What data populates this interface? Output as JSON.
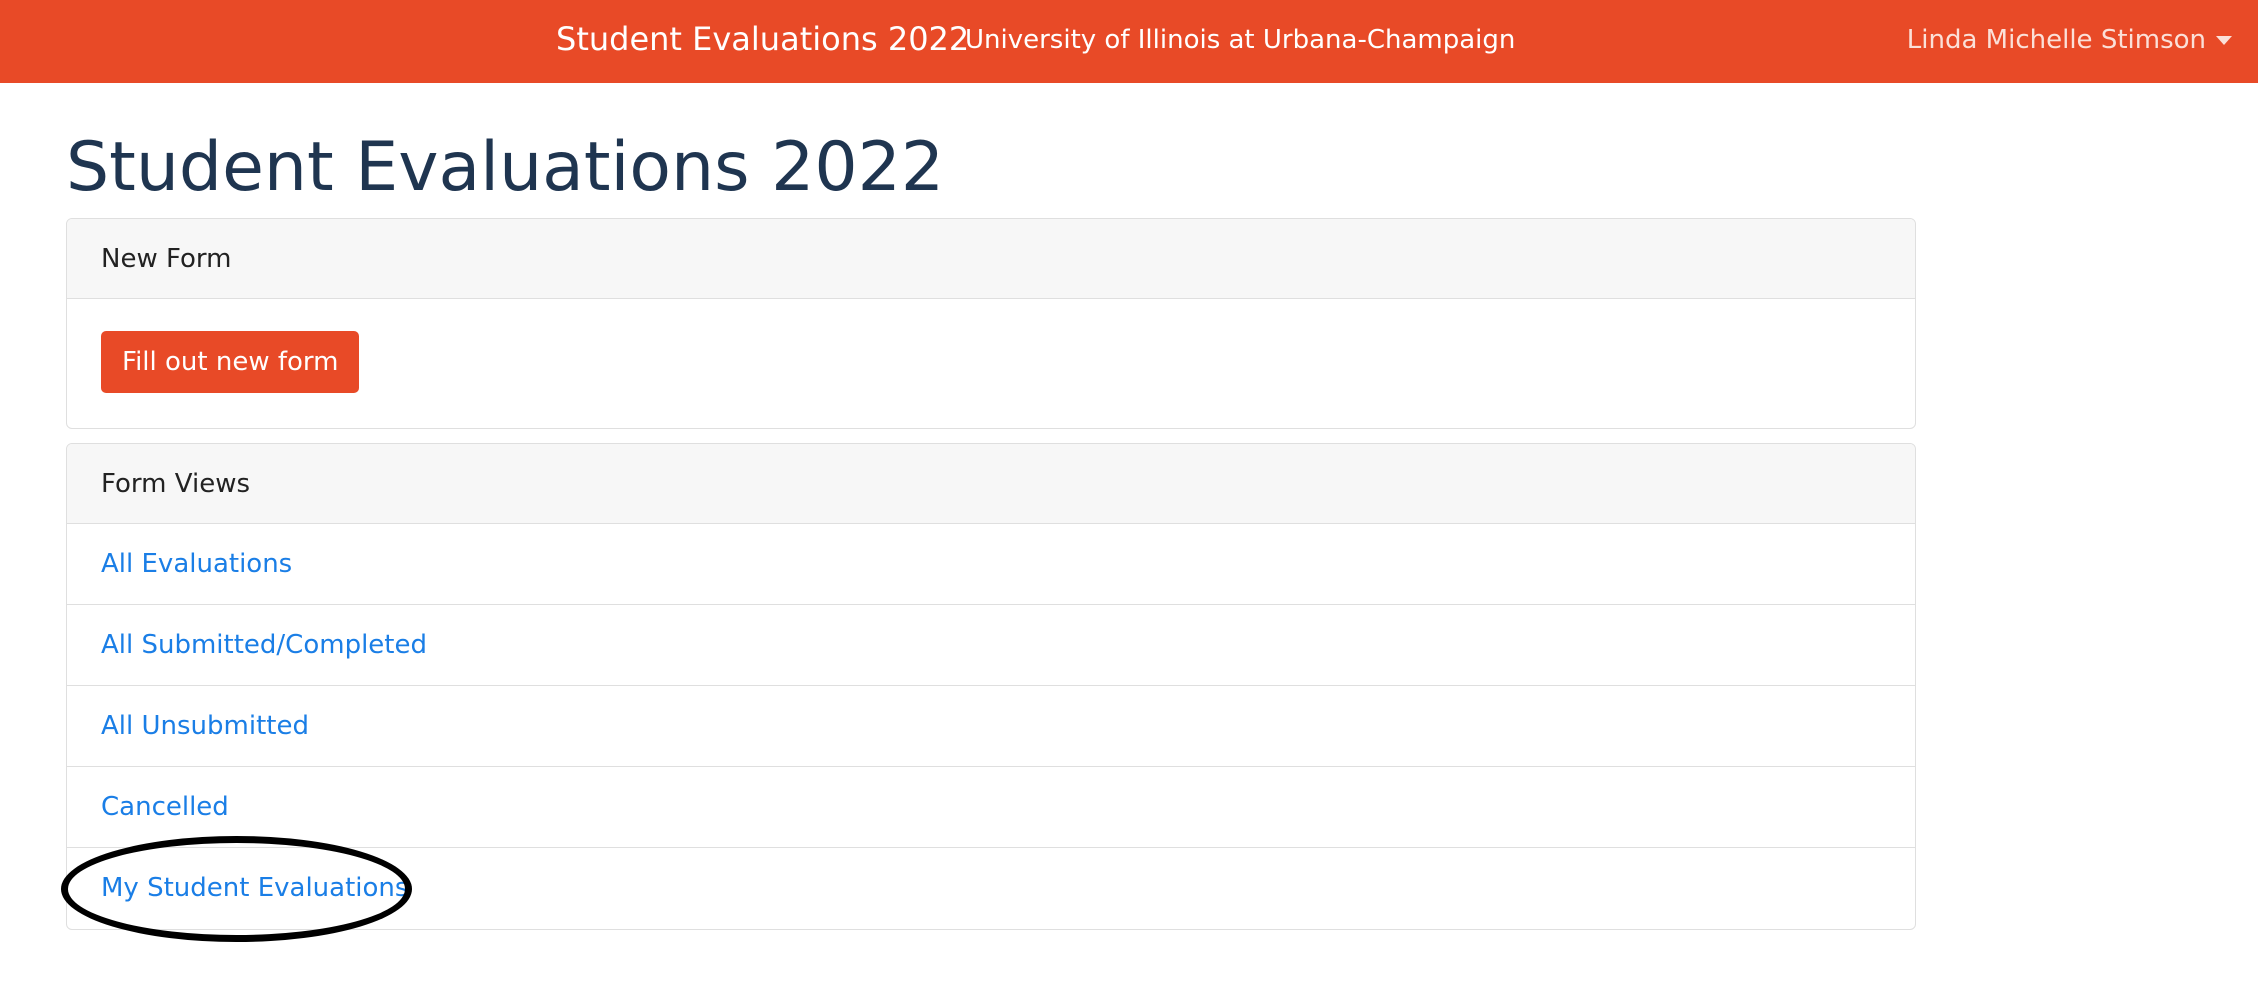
{
  "navbar": {
    "brand": "Student Evaluations 2022",
    "subtitle": "University of Illinois at Urbana-Champaign",
    "user_name": "Linda Michelle Stimson",
    "user_menu_icon": "caret-down-icon",
    "background_color": "#e84a27"
  },
  "page": {
    "title": "Student Evaluations 2022"
  },
  "new_form_card": {
    "header": "New Form",
    "button_label": "Fill out new form",
    "button_color": "#e84a27"
  },
  "form_views_card": {
    "header": "Form Views",
    "items": [
      {
        "label": "All Evaluations"
      },
      {
        "label": "All Submitted/Completed"
      },
      {
        "label": "All Unsubmitted"
      },
      {
        "label": "Cancelled"
      },
      {
        "label": "My Student Evaluations"
      }
    ],
    "link_color": "#1a7ee6"
  },
  "annotation": {
    "shape": "ellipse",
    "color": "#000000",
    "target": "My Student Evaluations"
  }
}
